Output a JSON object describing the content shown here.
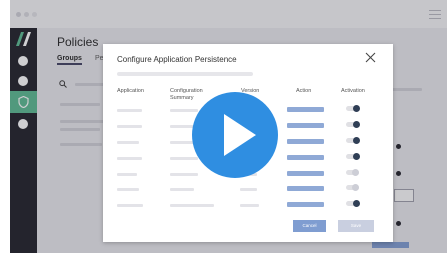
{
  "app": {
    "page_title": "Policies"
  },
  "tabs": [
    {
      "label": "Groups"
    },
    {
      "label": "Pe"
    }
  ],
  "modal": {
    "title": "Configure Application Persistence",
    "columns": {
      "application": "Application",
      "configuration_summary": "Configuration Summary",
      "version": "Version",
      "action": "Action",
      "activation": "Activation"
    },
    "rows": [
      {
        "activation": "on"
      },
      {
        "activation": "on"
      },
      {
        "activation": "on"
      },
      {
        "activation": "on"
      },
      {
        "activation": "off"
      },
      {
        "activation": "off"
      },
      {
        "activation": "on"
      }
    ],
    "cancel_label": "Cancel",
    "save_label": "Save"
  },
  "colors": {
    "sidebar_bg": "#1c1c24",
    "sidebar_active": "#58b98f",
    "accent_blue": "#7f9dd1",
    "play_button": "#2f8ee1",
    "toggle_on_knob": "#2f3e55"
  },
  "icons": {
    "logo": "brand-logo-icon",
    "menu": "hamburger-icon",
    "search": "search-icon",
    "close": "close-icon",
    "play": "play-icon",
    "shield": "shield-icon"
  }
}
